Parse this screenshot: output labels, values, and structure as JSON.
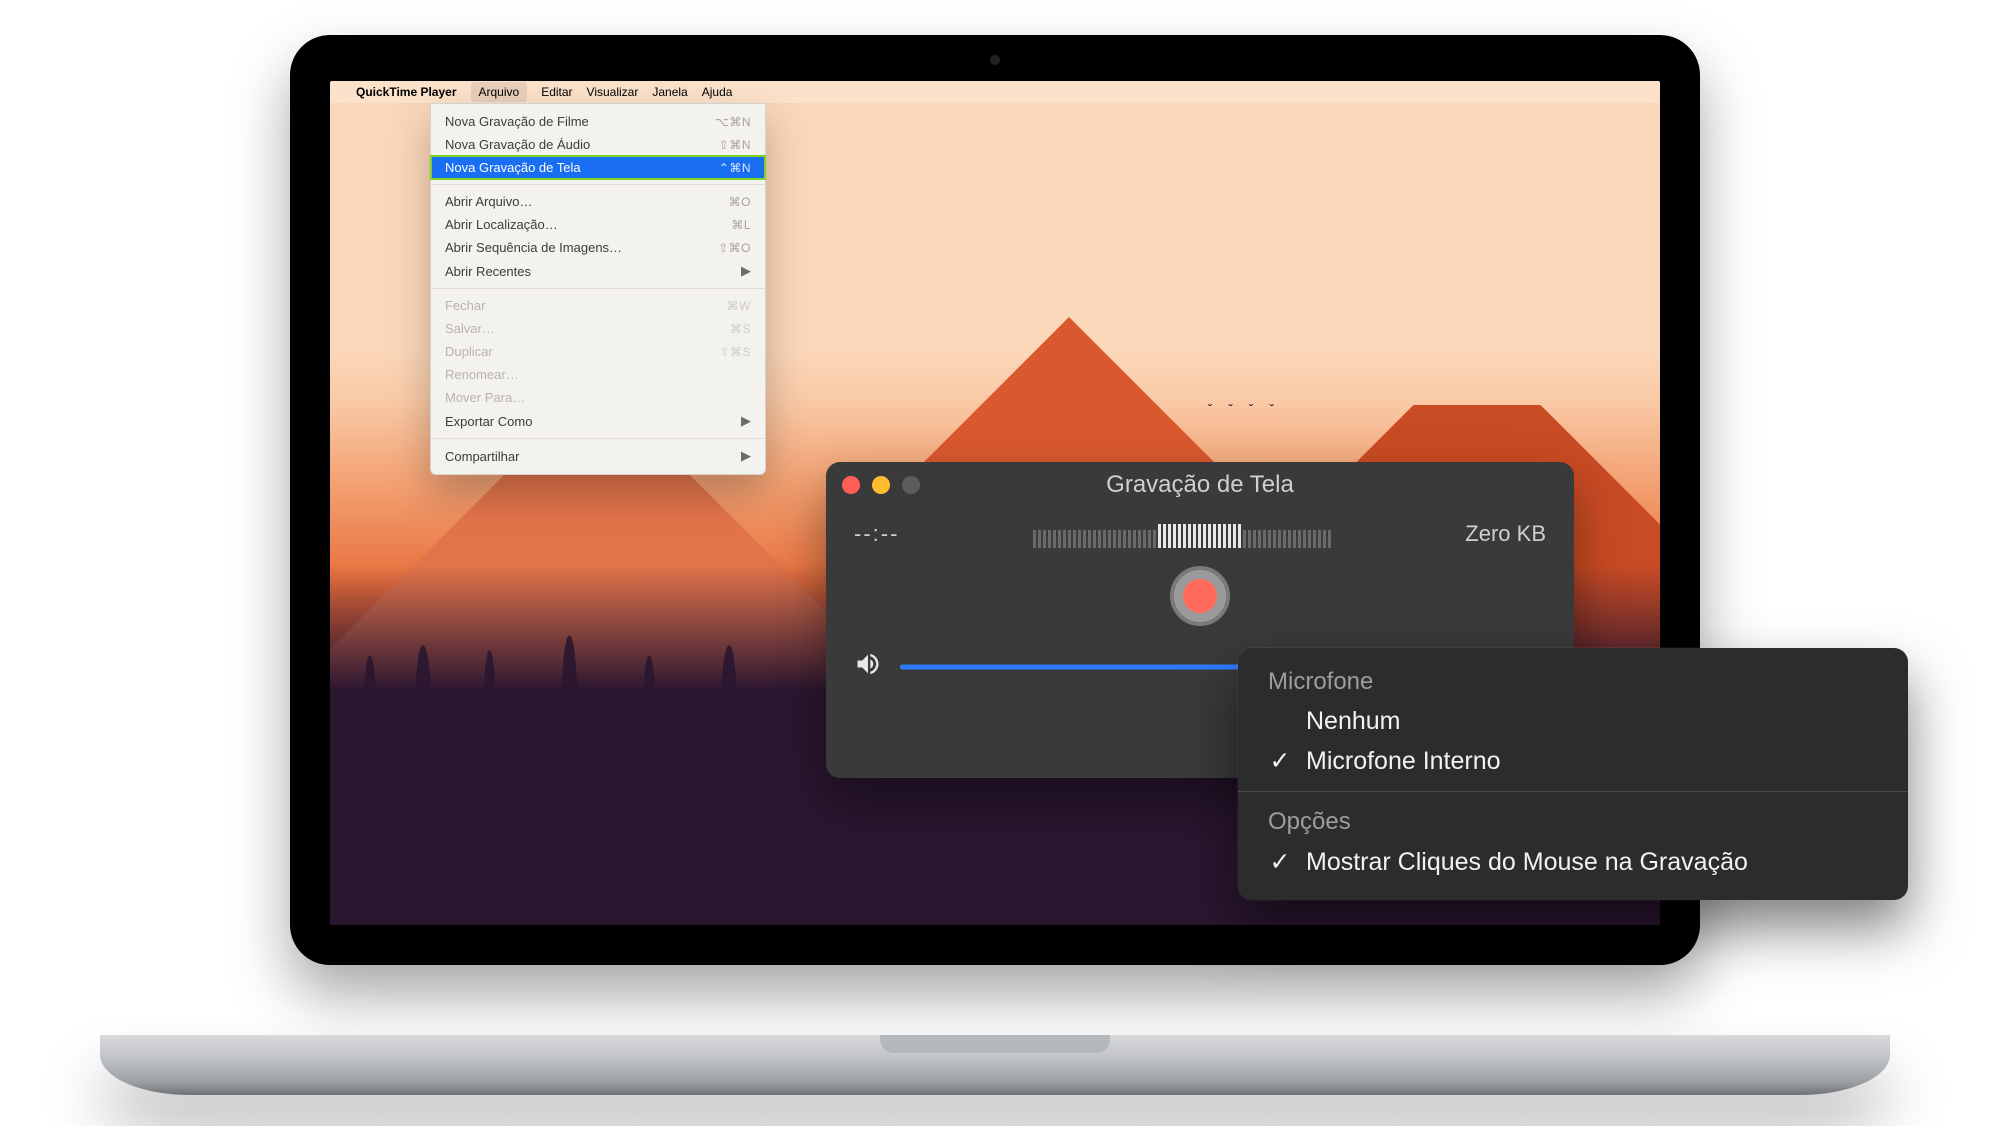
{
  "menubar": {
    "app_name": "QuickTime Player",
    "items": [
      "Arquivo",
      "Editar",
      "Visualizar",
      "Janela",
      "Ajuda"
    ],
    "active_index": 0
  },
  "dropdown": {
    "groups": [
      [
        {
          "label": "Nova Gravação de Filme",
          "shortcut": "⌥⌘N",
          "disabled": false
        },
        {
          "label": "Nova Gravação de Áudio",
          "shortcut": "⇧⌘N",
          "disabled": false
        },
        {
          "label": "Nova Gravação de Tela",
          "shortcut": "⌃⌘N",
          "disabled": false,
          "highlighted": true
        }
      ],
      [
        {
          "label": "Abrir Arquivo…",
          "shortcut": "⌘O",
          "disabled": false
        },
        {
          "label": "Abrir Localização…",
          "shortcut": "⌘L",
          "disabled": false
        },
        {
          "label": "Abrir Sequência de Imagens…",
          "shortcut": "⇧⌘O",
          "disabled": false
        },
        {
          "label": "Abrir Recentes",
          "shortcut": "",
          "submenu": true,
          "disabled": false
        }
      ],
      [
        {
          "label": "Fechar",
          "shortcut": "⌘W",
          "disabled": true
        },
        {
          "label": "Salvar…",
          "shortcut": "⌘S",
          "disabled": true
        },
        {
          "label": "Duplicar",
          "shortcut": "⇧⌘S",
          "disabled": true
        },
        {
          "label": "Renomear…",
          "shortcut": "",
          "disabled": true
        },
        {
          "label": "Mover Para…",
          "shortcut": "",
          "disabled": true
        },
        {
          "label": "Exportar Como",
          "shortcut": "",
          "submenu": true,
          "disabled": false
        }
      ],
      [
        {
          "label": "Compartilhar",
          "shortcut": "",
          "submenu": true,
          "disabled": false
        }
      ]
    ]
  },
  "recording_panel": {
    "title": "Gravação de Tela",
    "time": "--:--",
    "size": "Zero KB",
    "volume_percent": 58
  },
  "options_popover": {
    "mic_section": "Microfone",
    "mic_options": [
      {
        "label": "Nenhum",
        "checked": false
      },
      {
        "label": "Microfone Interno",
        "checked": true
      }
    ],
    "options_section": "Opções",
    "options": [
      {
        "label": "Mostrar Cliques do Mouse na Gravação",
        "checked": true
      }
    ]
  }
}
